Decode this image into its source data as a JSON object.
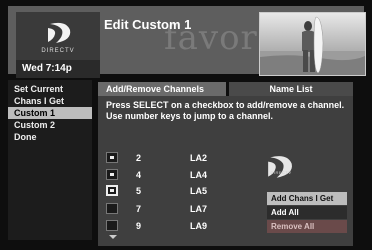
{
  "header": {
    "logo_text": "DIRECTV",
    "time": "Wed 7:14p",
    "watermark": "favorites",
    "title": "Edit Custom 1"
  },
  "left_menu": {
    "items": [
      {
        "label": "Set Current",
        "selected": false
      },
      {
        "label": "Chans I Get",
        "selected": false
      },
      {
        "label": "Custom 1",
        "selected": true
      },
      {
        "label": "Custom 2",
        "selected": false
      },
      {
        "label": "Done",
        "selected": false
      }
    ]
  },
  "tabs": [
    {
      "label": "Add/Remove Channels",
      "active": true
    },
    {
      "label": "Name List",
      "active": false
    }
  ],
  "instruction": "Press SELECT on a checkbox to add/remove a channel. Use number keys to jump to a channel.",
  "channels": [
    {
      "number": "2",
      "call": "LA2",
      "checked": true
    },
    {
      "number": "4",
      "call": "LA4",
      "checked": true
    },
    {
      "number": "5",
      "call": "LA5",
      "checked": true
    },
    {
      "number": "7",
      "call": "LA7",
      "checked": false
    },
    {
      "number": "9",
      "call": "LA9",
      "checked": false
    }
  ],
  "side_logo_text": "DIRECTV",
  "actions": [
    {
      "label": "Add Chans I Get",
      "state": "selected"
    },
    {
      "label": "Add All",
      "state": "normal"
    },
    {
      "label": "Remove All",
      "state": "dim"
    }
  ],
  "colors": {
    "background": "#0e0e0e",
    "header": "#5e5e5e",
    "panel": "#3f3f3f",
    "selected": "#bdbdbd"
  },
  "icons": {
    "logo": "directv-logo-icon",
    "scroll": "scroll-down-arrow-icon"
  }
}
